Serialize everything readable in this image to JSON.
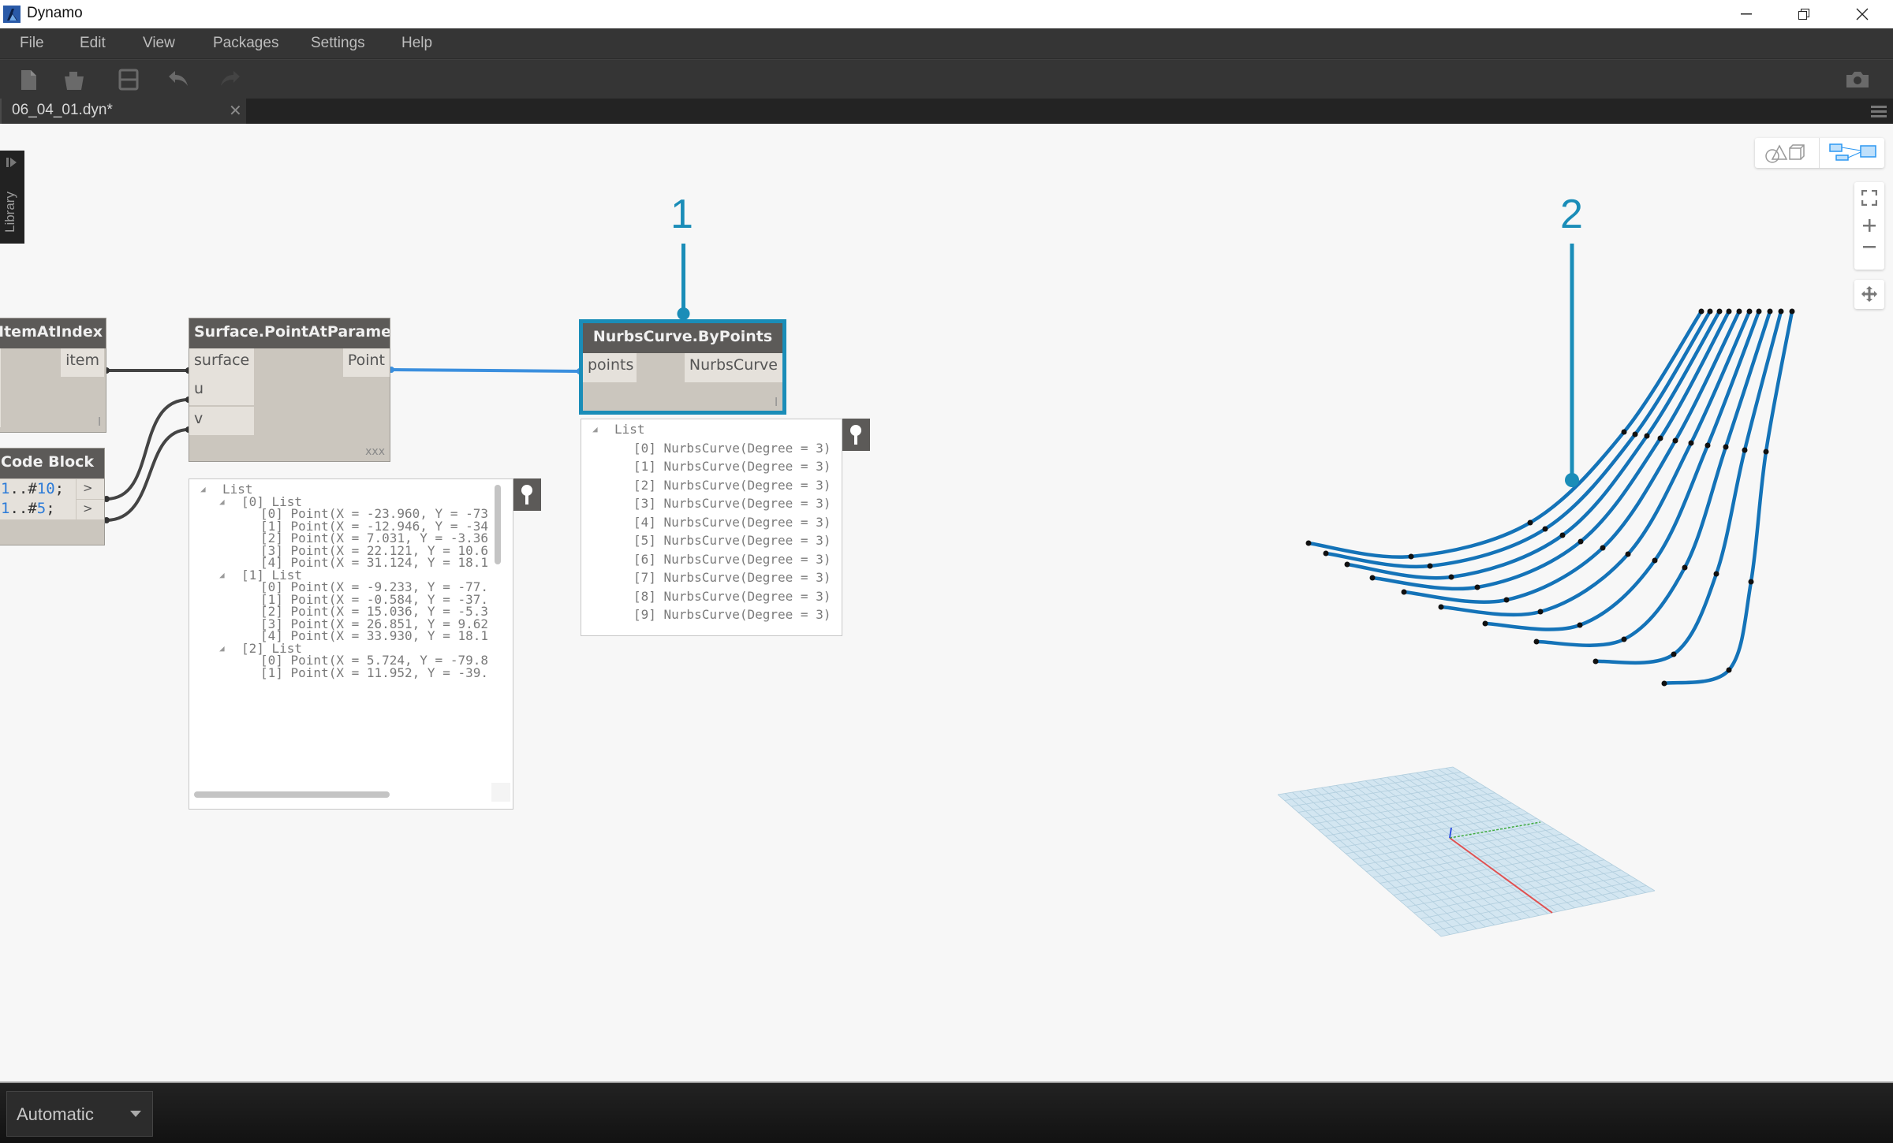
{
  "window": {
    "title": "Dynamo",
    "minimize_label": "—",
    "restore_label": "❐",
    "close_label": "✕"
  },
  "menu": [
    "File",
    "Edit",
    "View",
    "Packages",
    "Settings",
    "Help"
  ],
  "toolbar": {
    "buttons": [
      "new-file",
      "open-file",
      "save-file",
      "undo",
      "redo"
    ],
    "screenshot": "camera"
  },
  "tab": {
    "label": "06_04_01.dyn*",
    "close": "✕"
  },
  "library": {
    "label": "Library"
  },
  "nodes": {
    "get_item": {
      "title": "etItemAtIndex",
      "output": "item",
      "lacing": "l"
    },
    "code_block": {
      "title": "Code Block",
      "lines": [
        {
          "start": "1",
          "op": "..#",
          "count": "10",
          "end": ";"
        },
        {
          "start": "1",
          "op": "..#",
          "count": "5",
          "end": ";"
        }
      ],
      "output_label": ">"
    },
    "surface_point": {
      "title": "Surface.PointAtParameter",
      "inputs": [
        "surface",
        "u",
        "v"
      ],
      "output": "Point",
      "lacing": "xxx"
    },
    "nurbs": {
      "title": "NurbsCurve.ByPoints",
      "input": "points",
      "output": "NurbsCurve",
      "lacing": "l"
    }
  },
  "point_watch": {
    "root": "List",
    "rows": [
      {
        "indent": 1,
        "text": "[0] List",
        "toggle": true
      },
      {
        "indent": 2,
        "text": "[0] Point(X = -23.960, Y = -73"
      },
      {
        "indent": 2,
        "text": "[1] Point(X = -12.946, Y = -34"
      },
      {
        "indent": 2,
        "text": "[2] Point(X = 7.031, Y = -3.36"
      },
      {
        "indent": 2,
        "text": "[3] Point(X = 22.121, Y = 10.6"
      },
      {
        "indent": 2,
        "text": "[4] Point(X = 31.124, Y = 18.1"
      },
      {
        "indent": 1,
        "text": "[1] List",
        "toggle": true
      },
      {
        "indent": 2,
        "text": "[0] Point(X = -9.233, Y = -77."
      },
      {
        "indent": 2,
        "text": "[1] Point(X = -0.584, Y = -37."
      },
      {
        "indent": 2,
        "text": "[2] Point(X = 15.036, Y = -5.3"
      },
      {
        "indent": 2,
        "text": "[3] Point(X = 26.851, Y = 9.62"
      },
      {
        "indent": 2,
        "text": "[4] Point(X = 33.930, Y = 18.1"
      },
      {
        "indent": 1,
        "text": "[2] List",
        "toggle": true
      },
      {
        "indent": 2,
        "text": "[0] Point(X = 5.724, Y = -79.8"
      },
      {
        "indent": 2,
        "text": "[1] Point(X = 11.952, Y = -39."
      }
    ]
  },
  "nurbs_watch": {
    "root": "List",
    "rows": [
      "[0] NurbsCurve(Degree = 3)",
      "[1] NurbsCurve(Degree = 3)",
      "[2] NurbsCurve(Degree = 3)",
      "[3] NurbsCurve(Degree = 3)",
      "[4] NurbsCurve(Degree = 3)",
      "[5] NurbsCurve(Degree = 3)",
      "[6] NurbsCurve(Degree = 3)",
      "[7] NurbsCurve(Degree = 3)",
      "[8] NurbsCurve(Degree = 3)",
      "[9] NurbsCurve(Degree = 3)"
    ]
  },
  "callouts": [
    "1",
    "2"
  ],
  "viewport": {
    "curve_count": 10,
    "points_per_curve": 5,
    "colors": {
      "curve": "#1473b8",
      "point": "#111111",
      "callout": "#1a8db8",
      "wire_active": "#3b8fde",
      "wire": "#444444",
      "grid": "#bcd6e6",
      "axis_x": "#e05050",
      "axis_y": "#3faa3f",
      "axis_z": "#3050e0"
    }
  },
  "statusbar": {
    "run_mode": "Automatic"
  }
}
